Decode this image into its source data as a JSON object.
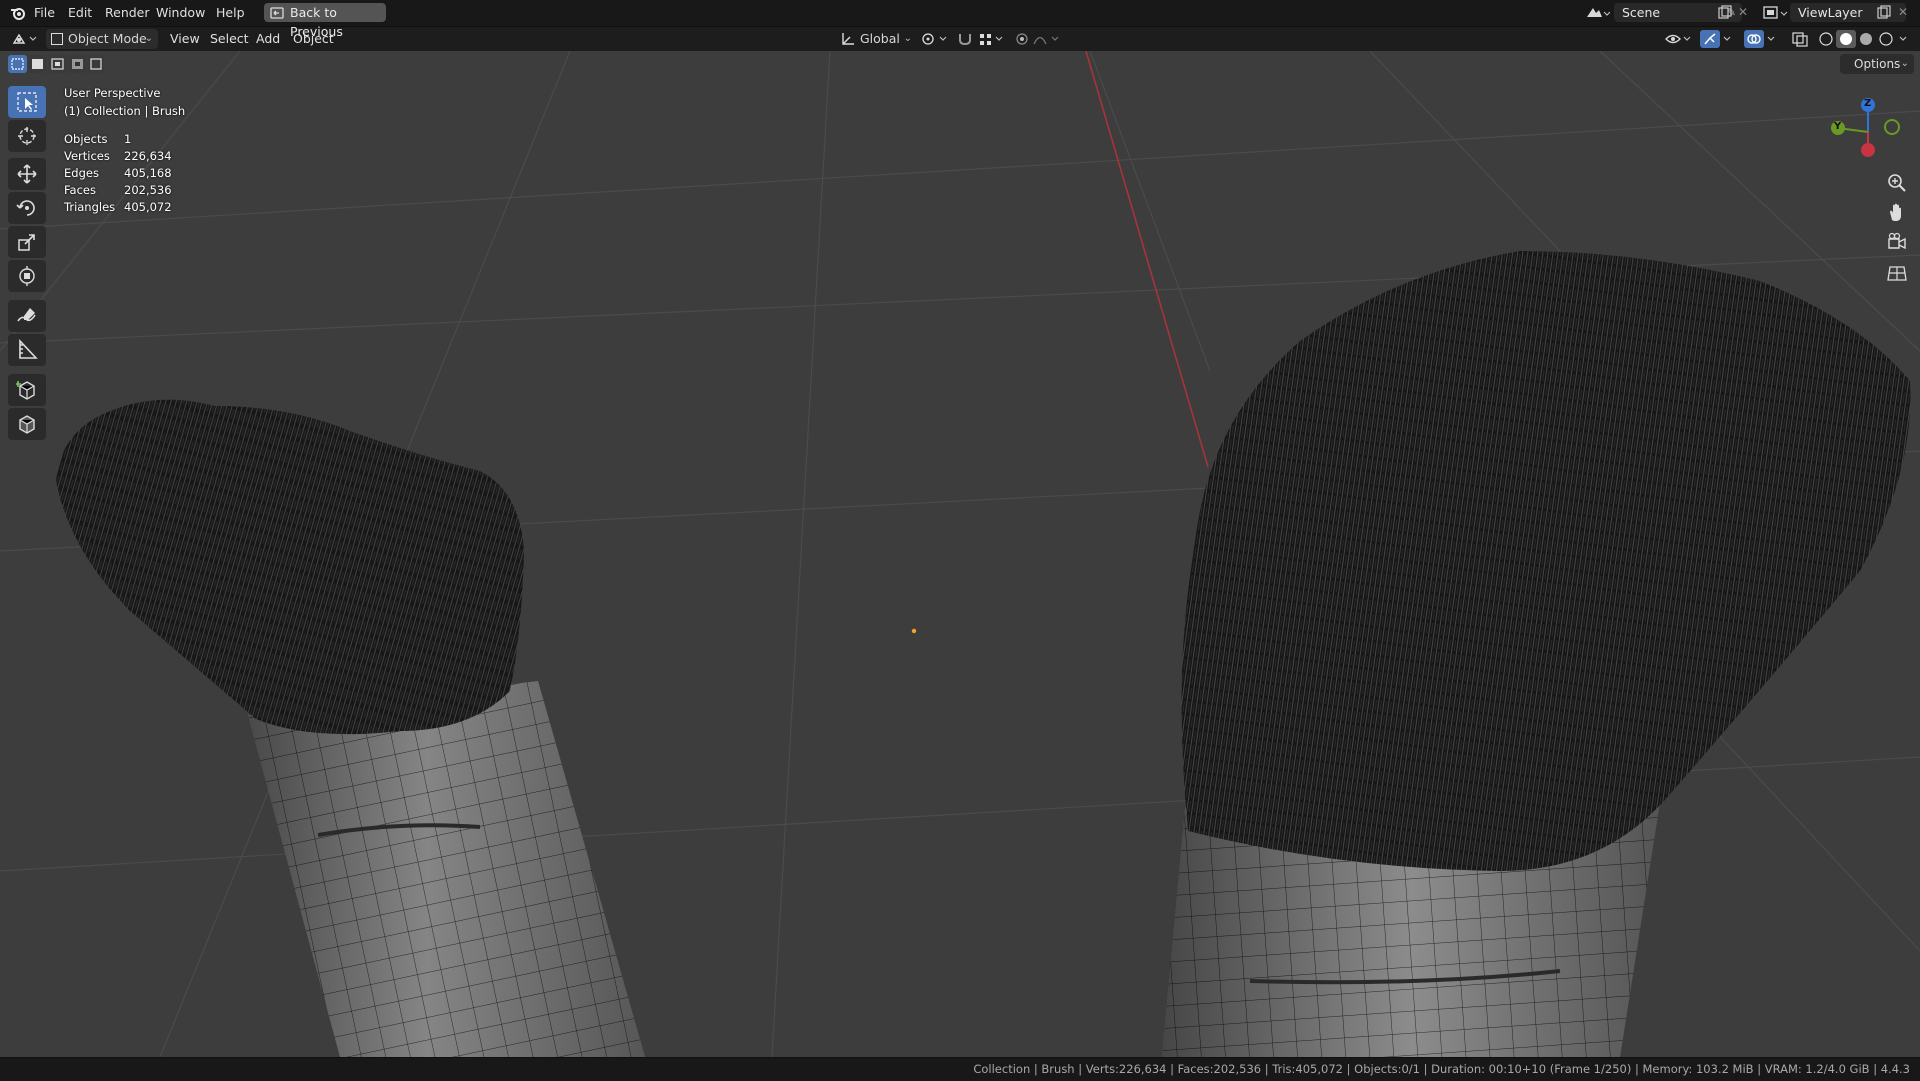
{
  "menubar": {
    "items": [
      "File",
      "Edit",
      "Render",
      "Window",
      "Help"
    ],
    "back_label": "Back to Previous",
    "scene_value": "Scene",
    "view_layer_value": "ViewLayer"
  },
  "header": {
    "mode": "Object Mode",
    "menus": [
      "View",
      "Select",
      "Add",
      "Object"
    ],
    "transform_orientation": "Global",
    "options_label": "Options"
  },
  "overlay": {
    "perspective": "User Perspective",
    "collection": "(1) Collection | Brush",
    "stats": [
      {
        "label": "Objects",
        "value": "1"
      },
      {
        "label": "Vertices",
        "value": "226,634"
      },
      {
        "label": "Edges",
        "value": "405,168"
      },
      {
        "label": "Faces",
        "value": "202,536"
      },
      {
        "label": "Triangles",
        "value": "405,072"
      }
    ]
  },
  "gizmo": {
    "z": "Z",
    "y": "Y"
  },
  "statusbar": {
    "text": "Collection | Brush | Verts:226,634 | Faces:202,536 | Tris:405,072 | Objects:0/1 | Duration: 00:10+10 (Frame 1/250) | Memory: 103.2 MiB | VRAM: 1.2/4.0 GiB | 4.4.3"
  },
  "colors": {
    "accent": "#4772b3",
    "x_axis": "#c8343f",
    "y_axis": "#6a9a23",
    "z_axis": "#2f74d6",
    "origin": "#f5a623"
  }
}
